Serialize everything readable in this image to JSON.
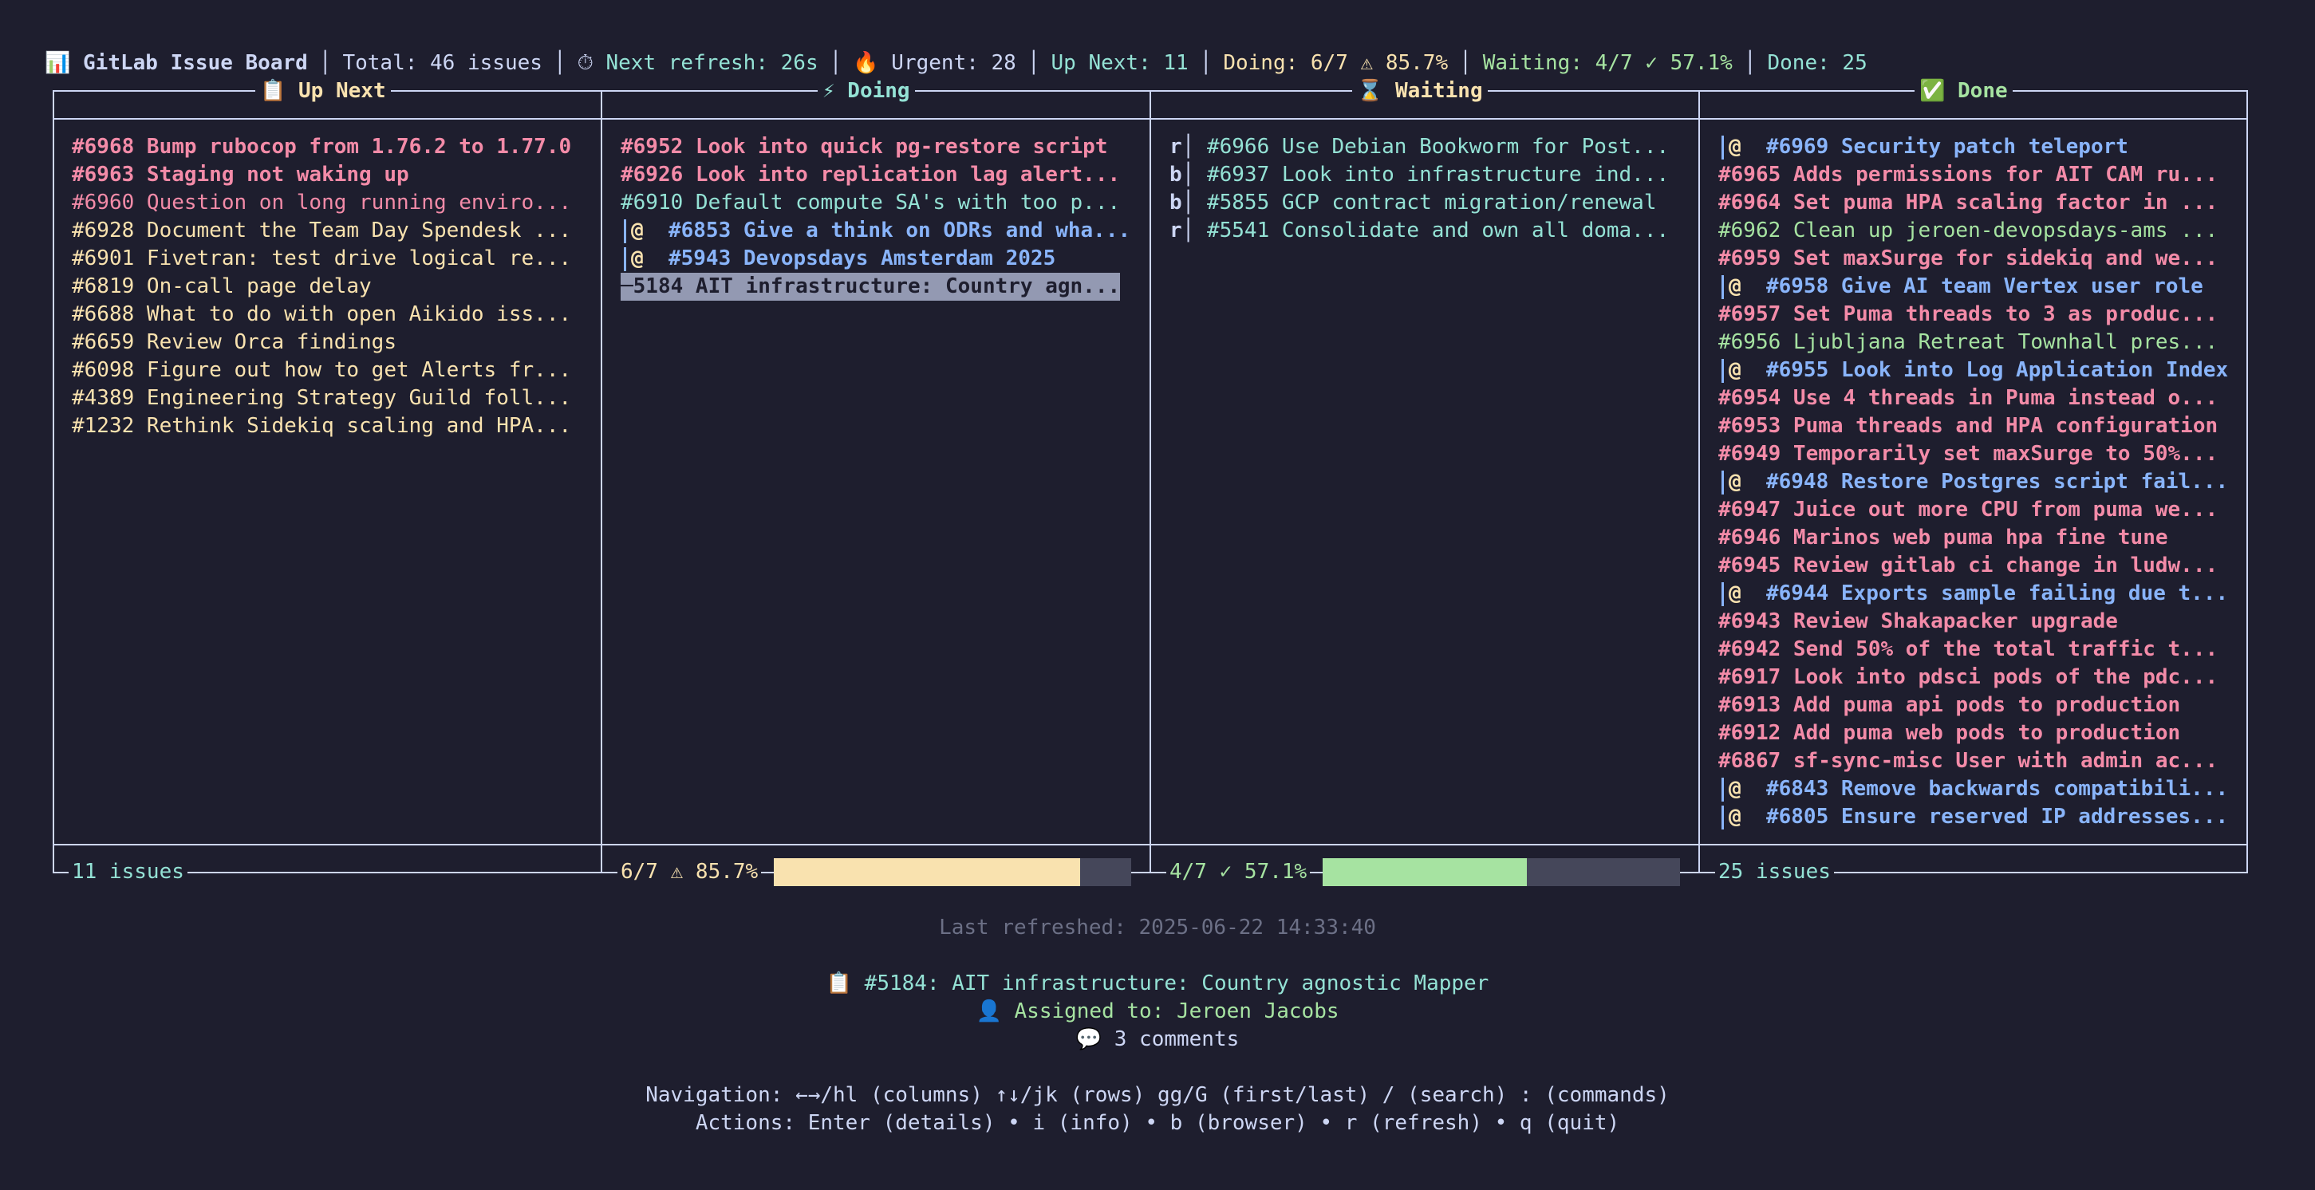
{
  "header": {
    "app_icon": "bar-chart-icon",
    "app_title": "GitLab Issue Board",
    "total": "Total: 46 issues",
    "refresh_icon": "stopwatch-icon",
    "next_refresh": "Next refresh: 26s",
    "urgent_icon": "fire-icon",
    "urgent": "Urgent: 28",
    "up_next": "Up Next: 11",
    "doing": "Doing: 6/7 ⚠ 85.7%",
    "waiting": "Waiting: 4/7 ✓ 57.1%",
    "done": "Done: 25"
  },
  "columns": {
    "up_next": {
      "title": "📋 Up Next",
      "footer": "11 issues",
      "items": [
        {
          "text": "#6968 Bump rubocop from 1.76.2 to 1.77.0",
          "color": "#f38ba8",
          "bold": true
        },
        {
          "text": "#6963 Staging not waking up",
          "color": "#f38ba8",
          "bold": true
        },
        {
          "text": "#6960 Question on long running enviro...",
          "color": "#f38ba8",
          "bold": false
        },
        {
          "text": "#6928 Document the Team Day Spendesk ...",
          "color": "#f9e2af",
          "bold": false
        },
        {
          "text": "#6901 Fivetran: test drive logical re...",
          "color": "#f9e2af",
          "bold": false
        },
        {
          "text": "#6819 On-call page delay",
          "color": "#f9e2af",
          "bold": false
        },
        {
          "text": "#6688 What to do with open Aikido iss...",
          "color": "#f9e2af",
          "bold": false
        },
        {
          "text": "#6659 Review Orca findings",
          "color": "#f9e2af",
          "bold": false
        },
        {
          "text": "#6098 Figure out how to get Alerts fr...",
          "color": "#f9e2af",
          "bold": false
        },
        {
          "text": "#4389 Engineering Strategy Guild foll...",
          "color": "#f9e2af",
          "bold": false
        },
        {
          "text": "#1232 Rethink Sidekiq scaling and HPA...",
          "color": "#f9e2af",
          "bold": false
        }
      ]
    },
    "doing": {
      "title": "⚡ Doing",
      "footer": "6/7 ⚠ 85.7%",
      "progress": 0.857,
      "progress_color": "#f9e2af",
      "items": [
        {
          "text": "#6952 Look into quick pg-restore script",
          "color": "#f38ba8",
          "bold": true,
          "prefix": ""
        },
        {
          "text": "#6926 Look into replication lag alert...",
          "color": "#f38ba8",
          "bold": true,
          "prefix": ""
        },
        {
          "text": "#6910 Default compute SA's with too p...",
          "color": "#94e2d5",
          "bold": false,
          "prefix": ""
        },
        {
          "text": "#6853 Give a think on ODRs and wha...",
          "color": "#89b4fa",
          "bold": true,
          "prefix": "@"
        },
        {
          "text": "#5943 Devopsdays Amsterdam 2025",
          "color": "#89b4fa",
          "bold": true,
          "prefix": "@"
        },
        {
          "text": "5184 AIT infrastructure: Country agn...",
          "color": "#1e1e2e",
          "bold": true,
          "prefix": "",
          "selected": true
        }
      ]
    },
    "waiting": {
      "title": "⌛ Waiting",
      "footer": "4/7 ✓ 57.1%",
      "progress": 0.571,
      "progress_color": "#a6e3a1",
      "items": [
        {
          "marker": "r",
          "text": "#6966 Use Debian Bookworm for Post..."
        },
        {
          "marker": "b",
          "text": "#6937 Look into infrastructure ind..."
        },
        {
          "marker": "b",
          "text": "#5855 GCP contract migration/renewal"
        },
        {
          "marker": "r",
          "text": "#5541 Consolidate and own all doma..."
        }
      ]
    },
    "done": {
      "title": "✅ Done",
      "footer": "25 issues",
      "items": [
        {
          "text": "#6969 Security patch teleport",
          "color": "#89b4fa",
          "bold": true,
          "prefix": "@"
        },
        {
          "text": "#6965 Adds permissions for AIT CAM ru...",
          "color": "#f38ba8",
          "bold": true,
          "prefix": ""
        },
        {
          "text": "#6964 Set puma HPA scaling factor in ...",
          "color": "#f38ba8",
          "bold": true,
          "prefix": ""
        },
        {
          "text": "#6962 Clean up jeroen-devopsdays-ams ...",
          "color": "#a6e3a1",
          "bold": false,
          "prefix": ""
        },
        {
          "text": "#6959 Set maxSurge for sidekiq and we...",
          "color": "#f38ba8",
          "bold": true,
          "prefix": ""
        },
        {
          "text": "#6958 Give AI team Vertex user role",
          "color": "#89b4fa",
          "bold": true,
          "prefix": "@"
        },
        {
          "text": "#6957 Set Puma threads to 3 as produc...",
          "color": "#f38ba8",
          "bold": true,
          "prefix": ""
        },
        {
          "text": "#6956 Ljubljana Retreat Townhall pres...",
          "color": "#a6e3a1",
          "bold": false,
          "prefix": ""
        },
        {
          "text": "#6955 Look into Log Application Index",
          "color": "#89b4fa",
          "bold": true,
          "prefix": "@"
        },
        {
          "text": "#6954 Use 4 threads in Puma instead o...",
          "color": "#f38ba8",
          "bold": true,
          "prefix": ""
        },
        {
          "text": "#6953 Puma threads and HPA configuration",
          "color": "#f38ba8",
          "bold": true,
          "prefix": ""
        },
        {
          "text": "#6949 Temporarily set maxSurge to 50%...",
          "color": "#f38ba8",
          "bold": true,
          "prefix": ""
        },
        {
          "text": "#6948 Restore Postgres script fail...",
          "color": "#89b4fa",
          "bold": true,
          "prefix": "@"
        },
        {
          "text": "#6947 Juice out more CPU from puma we...",
          "color": "#f38ba8",
          "bold": true,
          "prefix": ""
        },
        {
          "text": "#6946 Marinos web puma hpa fine tune",
          "color": "#f38ba8",
          "bold": true,
          "prefix": ""
        },
        {
          "text": "#6945 Review gitlab ci change in ludw...",
          "color": "#f38ba8",
          "bold": true,
          "prefix": ""
        },
        {
          "text": "#6944 Exports sample failing due t...",
          "color": "#89b4fa",
          "bold": true,
          "prefix": "@"
        },
        {
          "text": "#6943 Review Shakapacker upgrade",
          "color": "#f38ba8",
          "bold": true,
          "prefix": ""
        },
        {
          "text": "#6942 Send 50% of the total traffic t...",
          "color": "#f38ba8",
          "bold": true,
          "prefix": ""
        },
        {
          "text": "#6917 Look into pdsci pods of the pdc...",
          "color": "#f38ba8",
          "bold": true,
          "prefix": ""
        },
        {
          "text": "#6913 Add puma api pods to production",
          "color": "#f38ba8",
          "bold": true,
          "prefix": ""
        },
        {
          "text": "#6912 Add puma web pods to production",
          "color": "#f38ba8",
          "bold": true,
          "prefix": ""
        },
        {
          "text": "#6867 sf-sync-misc User with admin ac...",
          "color": "#f38ba8",
          "bold": true,
          "prefix": ""
        },
        {
          "text": "#6843 Remove backwards compatibili...",
          "color": "#89b4fa",
          "bold": true,
          "prefix": "@"
        },
        {
          "text": "#6805 Ensure reserved IP addresses...",
          "color": "#89b4fa",
          "bold": true,
          "prefix": "@"
        }
      ]
    }
  },
  "status": {
    "last_refreshed": "Last refreshed: 2025-06-22 14:33:40"
  },
  "details": {
    "issue_icon": "clipboard-icon",
    "issue": "#5184: AIT infrastructure: Country agnostic Mapper",
    "user_icon": "person-icon",
    "assigned": "Assigned to: Jeroen Jacobs",
    "comment_icon": "speech-bubble-icon",
    "comments": "3 comments"
  },
  "help": {
    "navigation": "Navigation: ←→/hl (columns) ↑↓/jk (rows) gg/G (first/last) / (search) : (commands)",
    "actions": "Actions: Enter (details) • i (info) • b (browser) • r (refresh) • q (quit)"
  },
  "colors": {
    "background": "#1e1e2e",
    "text": "#cdd6f4",
    "teal": "#94e2d5",
    "red": "#f38ba8",
    "yellow": "#f9e2af",
    "green": "#a6e3a1",
    "blue": "#89b4fa",
    "muted": "#6c7086"
  }
}
